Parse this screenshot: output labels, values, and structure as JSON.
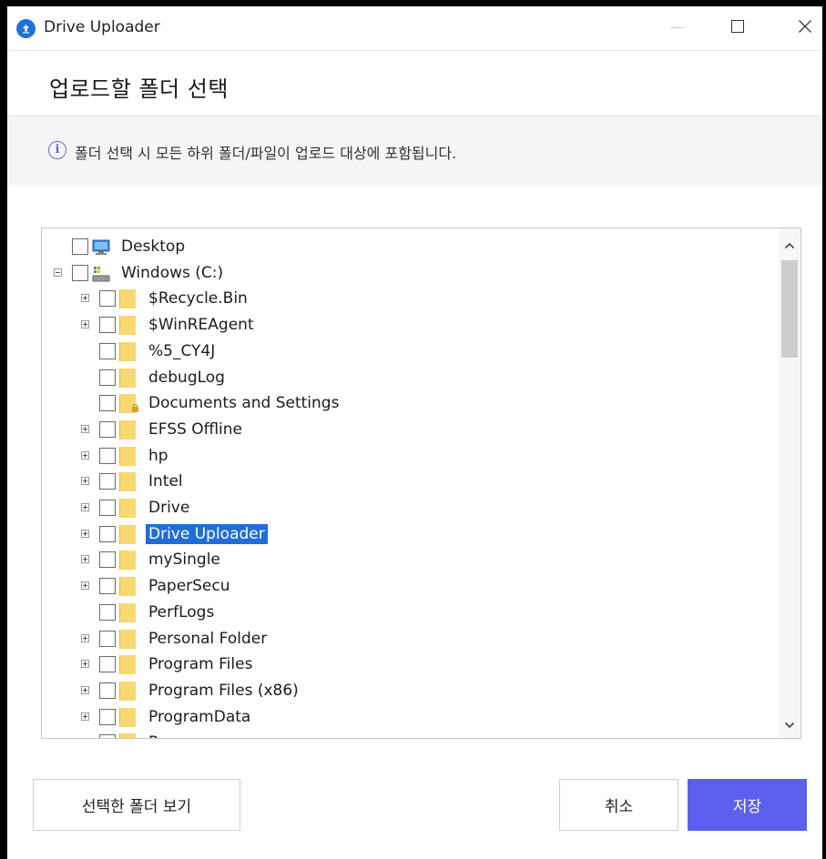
{
  "window": {
    "title": "Drive Uploader"
  },
  "header": {
    "title": "업로드할 폴더 선택"
  },
  "info": {
    "text": "폴더 선택 시 모든 하위 폴더/파일이 업로드 대상에 포함됩니다."
  },
  "tree": {
    "items": [
      {
        "label": "Desktop",
        "icon": "desktop-icon",
        "expander": "none",
        "checked": false,
        "selected": false,
        "level": 0
      },
      {
        "label": "Windows (C:)",
        "icon": "drive-icon",
        "expander": "minus",
        "checked": false,
        "selected": false,
        "level": 0
      },
      {
        "label": "$Recycle.Bin",
        "icon": "folder-icon",
        "expander": "plus",
        "checked": false,
        "selected": false,
        "level": 1
      },
      {
        "label": "$WinREAgent",
        "icon": "folder-icon",
        "expander": "plus",
        "checked": false,
        "selected": false,
        "level": 1
      },
      {
        "label": "%5_CY4J",
        "icon": "folder-icon",
        "expander": "none",
        "checked": false,
        "selected": false,
        "level": 1
      },
      {
        "label": "debugLog",
        "icon": "folder-icon",
        "expander": "none",
        "checked": false,
        "selected": false,
        "level": 1
      },
      {
        "label": "Documents and Settings",
        "icon": "locked-folder-icon",
        "expander": "none",
        "checked": false,
        "selected": false,
        "level": 1
      },
      {
        "label": "EFSS Offline",
        "icon": "folder-icon",
        "expander": "plus",
        "checked": false,
        "selected": false,
        "level": 1
      },
      {
        "label": "hp",
        "icon": "folder-icon",
        "expander": "plus",
        "checked": false,
        "selected": false,
        "level": 1
      },
      {
        "label": "Intel",
        "icon": "folder-icon",
        "expander": "plus",
        "checked": false,
        "selected": false,
        "level": 1
      },
      {
        "label": "Drive",
        "icon": "folder-icon",
        "expander": "plus",
        "checked": false,
        "selected": false,
        "level": 1
      },
      {
        "label": "Drive Uploader",
        "icon": "folder-icon",
        "expander": "plus",
        "checked": false,
        "selected": true,
        "level": 1
      },
      {
        "label": "mySingle",
        "icon": "folder-icon",
        "expander": "plus",
        "checked": false,
        "selected": false,
        "level": 1
      },
      {
        "label": "PaperSecu",
        "icon": "folder-icon",
        "expander": "plus",
        "checked": false,
        "selected": false,
        "level": 1
      },
      {
        "label": "PerfLogs",
        "icon": "folder-icon",
        "expander": "none",
        "checked": false,
        "selected": false,
        "level": 1
      },
      {
        "label": "Personal Folder",
        "icon": "folder-icon",
        "expander": "plus",
        "checked": false,
        "selected": false,
        "level": 1
      },
      {
        "label": "Program Files",
        "icon": "folder-icon",
        "expander": "plus",
        "checked": false,
        "selected": false,
        "level": 1
      },
      {
        "label": "Program Files (x86)",
        "icon": "folder-icon",
        "expander": "plus",
        "checked": false,
        "selected": false,
        "level": 1
      },
      {
        "label": "ProgramData",
        "icon": "folder-icon",
        "expander": "plus",
        "checked": false,
        "selected": false,
        "level": 1
      },
      {
        "label": "Recovery",
        "icon": "folder-icon",
        "expander": "plus",
        "checked": false,
        "selected": false,
        "level": 1
      }
    ]
  },
  "buttons": {
    "view_selected": "선택한 폴더 보기",
    "cancel": "취소",
    "save": "저장"
  },
  "colors": {
    "accent": "#5b5fee",
    "selection": "#1f6ddb",
    "folder": "#f9d871",
    "app_icon": "#1e6fe0"
  }
}
